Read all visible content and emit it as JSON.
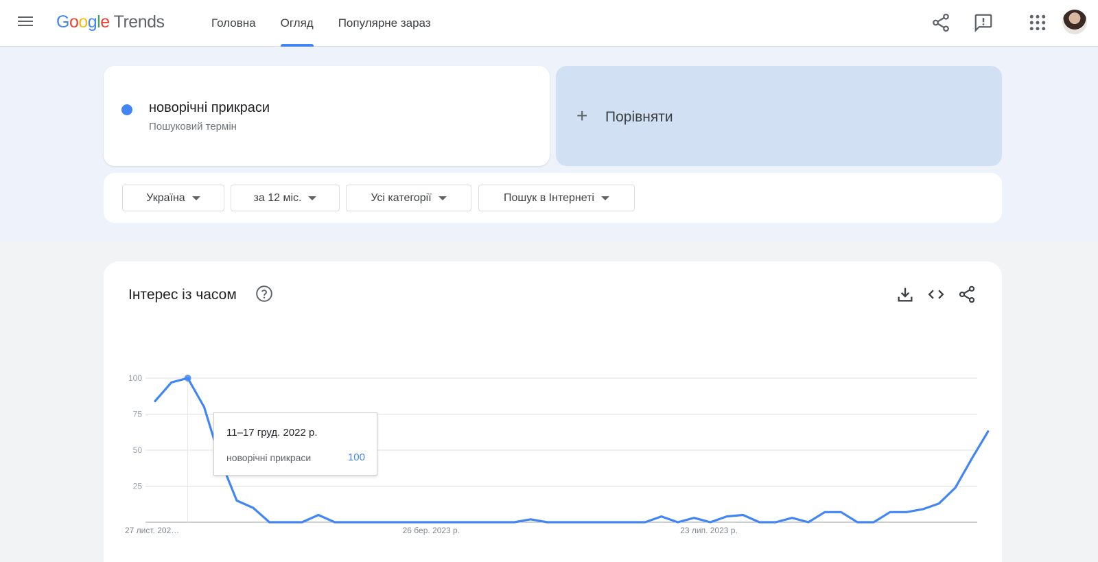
{
  "header": {
    "logo": {
      "google": [
        "G",
        "o",
        "o",
        "g",
        "l",
        "e"
      ],
      "trends": "Trends"
    },
    "tabs": [
      {
        "label": "Головна"
      },
      {
        "label": "Огляд",
        "active": true
      },
      {
        "label": "Популярне зараз"
      }
    ],
    "icons": [
      "menu-icon",
      "share-icon",
      "feedback-icon",
      "apps-icon",
      "account-avatar"
    ]
  },
  "search": {
    "term": "новорічні прикраси",
    "term_type": "Пошуковий термін",
    "term_color": "#4285f4",
    "compare_label": "Порівняти"
  },
  "filters": [
    {
      "label": "Україна"
    },
    {
      "label": "за 12 міс."
    },
    {
      "label": "Усі категорії"
    },
    {
      "label": "Пошук в Інтернеті"
    }
  ],
  "chart_panel": {
    "title": "Інтерес із часом",
    "icons": [
      "help-icon",
      "download-icon",
      "embed-icon",
      "share-icon"
    ]
  },
  "tooltip": {
    "date": "11–17 груд. 2022 р.",
    "term": "новорічні прикраси",
    "value": "100"
  },
  "colors": {
    "accent": "#4285f4",
    "compare_bg": "#d2e0f4",
    "page_bg": "#eef2fa"
  },
  "chart_data": {
    "type": "line",
    "title": "Інтерес із часом",
    "x_tick_labels": [
      "27 лист. 202…",
      "26 бер. 2023 р.",
      "23 лип. 2023 р."
    ],
    "x_tick_index": [
      0,
      17,
      34
    ],
    "ylim": [
      0,
      100
    ],
    "y_ticks": [
      0,
      25,
      50,
      75,
      100
    ],
    "y_tick_labels": [
      "25",
      "50",
      "75",
      "100"
    ],
    "grid": true,
    "highlight_index": 2,
    "series": [
      {
        "name": "новорічні прикраси",
        "color": "#4285f4",
        "values": [
          84,
          97,
          100,
          80,
          43,
          15,
          10,
          0,
          0,
          0,
          5,
          0,
          0,
          0,
          0,
          0,
          0,
          0,
          0,
          0,
          0,
          0,
          0,
          2,
          0,
          0,
          0,
          0,
          0,
          0,
          0,
          4,
          0,
          3,
          0,
          4,
          5,
          0,
          0,
          3,
          0,
          7,
          7,
          0,
          0,
          7,
          7,
          9,
          13,
          24,
          44,
          63
        ]
      }
    ]
  }
}
